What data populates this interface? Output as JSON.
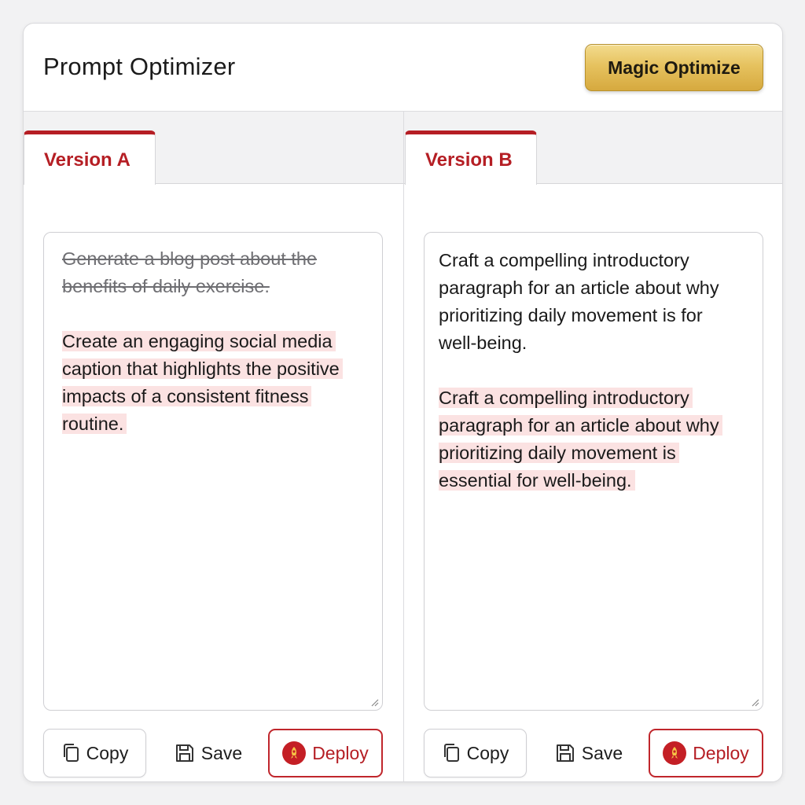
{
  "header": {
    "title": "Prompt Optimizer",
    "magic_button": "Magic Optimize"
  },
  "panels": [
    {
      "tab": "Version A",
      "original_text": "Generate a blog post about the benefits of daily exercise.",
      "highlighted_text": "Create an engaging social media caption that highlights the positive impacts of a consistent fitness routine.",
      "actions": {
        "copy": "Copy",
        "save": "Save",
        "deploy": "Deploy"
      }
    },
    {
      "tab": "Version B",
      "original_text": "Craft a compelling introductory paragraph for an article about why prioritizing daily movement is for well-being.",
      "highlighted_text": "Craft a compelling introductory paragraph for an article about why prioritizing daily movement is essential for well-being.",
      "actions": {
        "copy": "Copy",
        "save": "Save",
        "deploy": "Deploy"
      }
    }
  ],
  "colors": {
    "accent": "#b51e24",
    "highlight": "#fbe2e2",
    "gold": "#e6c25f"
  },
  "icons": {
    "copy": "copy-icon",
    "save": "save-icon",
    "deploy": "rocket-icon",
    "resize": "resize-handle-icon"
  }
}
